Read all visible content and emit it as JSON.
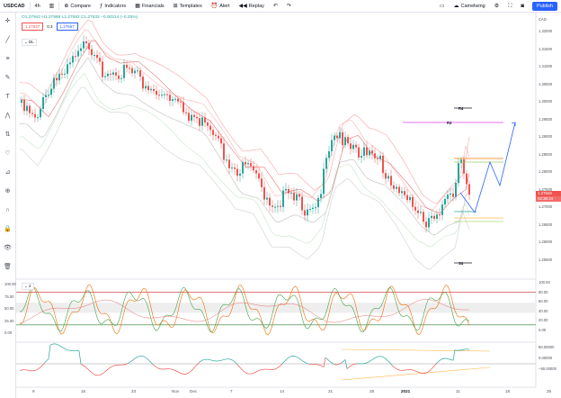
{
  "toolbar": {
    "symbol": "USDCAD",
    "interval": "4h",
    "compare": "Compare",
    "indicators": "Indicators",
    "financials": "Financials",
    "templates": "Templates",
    "alert": "Alert",
    "replay": "Replay",
    "layout_name": "Camelwing",
    "publish": "Publish"
  },
  "legend": {
    "ohlc": "O1.27942  H1.27968  L1.27593  C1.27633  −0.00314 (−0.25%)",
    "bid_price": "1.27637",
    "spread": "0.3",
    "ask_price": "1.27667",
    "indicator_label": "DL",
    "osc_label": "2"
  },
  "price_axis": {
    "currency": "CAD",
    "ticks": [
      "1.32000",
      "1.31500",
      "1.31000",
      "1.30500",
      "1.30000",
      "1.29500",
      "1.29000",
      "1.28500",
      "1.28000",
      "1.27500",
      "1.27000",
      "1.26500",
      "1.26000",
      "1.25500"
    ],
    "last_price": "1.27634",
    "countdown": "02:38:24"
  },
  "osc_axis": {
    "ticks": [
      "100.00",
      "80.00",
      "60.00",
      "40.00",
      "20.00",
      "0.00"
    ],
    "left_ticks": [
      "100.00",
      "75.00",
      "50.00",
      "25.00",
      "0.00"
    ]
  },
  "cci_axis": {
    "ticks": [
      "90.00000",
      "0.00000",
      "−90.00000"
    ]
  },
  "levels": {
    "r4": "R4",
    "r3": "R3",
    "s4": "S4"
  },
  "time_axis": {
    "labels": [
      "9",
      "16",
      "23",
      "Nov",
      "Dec",
      "7",
      "14",
      "21",
      "28",
      "2021",
      "11",
      "18",
      "25"
    ],
    "bold_index": 9
  },
  "colors": {
    "up": "#26a69a",
    "down": "#ef5350",
    "projection": "#2962ff",
    "pivot_line": "#e040fb",
    "accent": "#2962ff"
  }
}
